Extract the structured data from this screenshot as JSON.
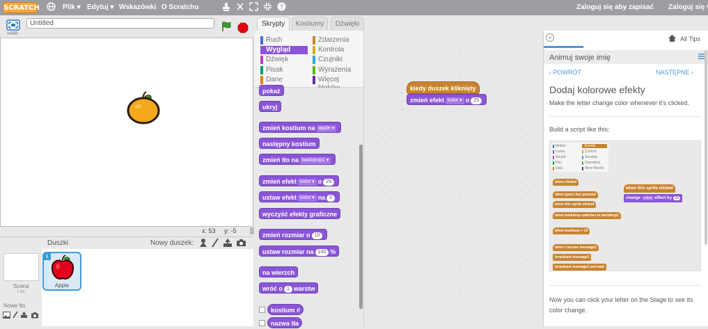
{
  "menubar": {
    "logo": "SCRATCH",
    "file": "Plik ▾",
    "edit": "Edytuj ▾",
    "tips": "Wskazówki",
    "about": "O Scratchu",
    "signin_save": "Zaloguj się aby zapisać",
    "signin": "Zaloguj się ▾"
  },
  "stage": {
    "title_value": "Untitled",
    "version": "v448",
    "coords_x_label": "x:",
    "coords_x": "53",
    "coords_y_label": "y:",
    "coords_y": "-5"
  },
  "sprites": {
    "header": "Duszki",
    "new_sprite": "Nowy duszek:",
    "scene_label": "Scena",
    "scene_sub": "1 tło",
    "new_backdrop": "Nowe tło",
    "apple_label": "Apple"
  },
  "tabs": {
    "scripts": "Skrypty",
    "costumes": "Kostiumy",
    "sounds": "Dźwięki"
  },
  "categories": [
    {
      "label": "Ruch",
      "color": "#4a6cd4"
    },
    {
      "label": "Zdarzenia",
      "color": "#c88330"
    },
    {
      "label": "Wygląd",
      "color": "#8a55d7"
    },
    {
      "label": "Kontrola",
      "color": "#e1a91a"
    },
    {
      "label": "Dźwięk",
      "color": "#bb42c3"
    },
    {
      "label": "Czujniki",
      "color": "#2ca5e2"
    },
    {
      "label": "Pisak",
      "color": "#0e9a6c"
    },
    {
      "label": "Wyrażenia",
      "color": "#5cb712"
    },
    {
      "label": "Dane",
      "color": "#ee7d16"
    },
    {
      "label": "Więcej bloków",
      "color": "#632d99"
    }
  ],
  "palette": {
    "show": "pokaż",
    "hide": "ukryj",
    "switch_costume": "zmień kostium na",
    "switch_costume_val": "apple",
    "next_costume": "następny kostium",
    "switch_backdrop": "zmień tło na",
    "switch_backdrop_val": "backdrop1",
    "change_effect": "zmień efekt",
    "change_effect_val": "kolor",
    "change_effect_o": "o",
    "change_effect_num": "25",
    "set_effect": "ustaw efekt",
    "set_effect_val": "kolor",
    "set_effect_na": "na",
    "set_effect_num": "0",
    "clear_effects": "wyczyść efekty graficzne",
    "change_size": "zmień rozmiar o",
    "change_size_num": "10",
    "set_size": "ustaw rozmiar na",
    "set_size_num": "100",
    "set_size_pct": "%",
    "front": "na wierzch",
    "back": "wróć o",
    "back_num": "1",
    "back_tail": "warstw",
    "costume_num": "kostium #",
    "backdrop_name": "nazwa tła"
  },
  "script": {
    "hat": "kiedy duszek kliknięty",
    "cmd": "zmień efekt",
    "cmd_val": "kolor",
    "cmd_o": "o",
    "cmd_num": "25"
  },
  "tips": {
    "all_tips": "All Tips",
    "tutorial_title": "Animuj swoje imię",
    "back": "POWRÓT",
    "next": "NASTĘPNE",
    "heading": "Dodaj kolorowe efekty",
    "desc": "Make the letter change color whenever it's clicked.",
    "build": "Build a script like this:",
    "img_cats": [
      "Motion",
      "Events",
      "Looks",
      "Control",
      "Sound",
      "Sensing",
      "Pen",
      "Operators",
      "Data",
      "More Blocks"
    ],
    "img_blocks": [
      "when clicked",
      "when space key pressed",
      "when this sprite clicked",
      "when backdrop switches to backdrop1",
      "when loudness > 10",
      "when I receive message1",
      "broadcast message1",
      "broadcast message1 and wait"
    ],
    "img_hat": "when this sprite clicked",
    "img_cmd_a": "change",
    "img_cmd_val": "color",
    "img_cmd_b": "effect by",
    "img_cmd_num": "25",
    "footer": "Now you can click your letter on the Stage to see its color change."
  }
}
